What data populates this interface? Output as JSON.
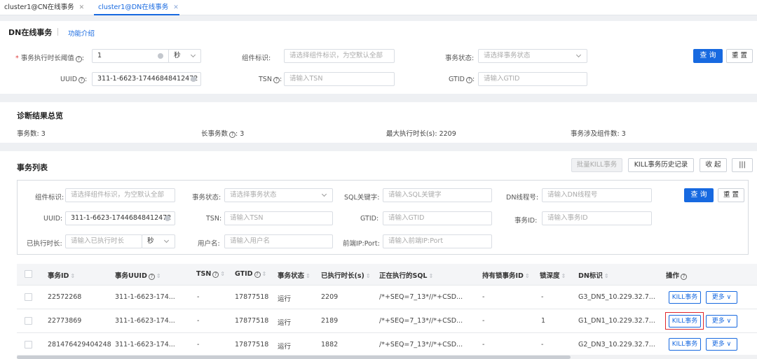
{
  "tabs": [
    {
      "label": "cluster1@CN在线事务",
      "active": false
    },
    {
      "label": "cluster1@DN在线事务",
      "active": true
    }
  ],
  "header": {
    "title": "DN在线事务",
    "intro_link": "功能介绍"
  },
  "query": {
    "threshold_label": "事务执行时长阈值",
    "threshold_value": "1",
    "unit": "秒",
    "component_label": "组件标识:",
    "component_placeholder": "请选择组件标识，为空默认全部",
    "state_label": "事务状态:",
    "state_placeholder": "请选择事务状态",
    "uuid_label": "UUID",
    "uuid_value": "311-1-6623-17446848412472",
    "tsn_label": "TSN",
    "tsn_placeholder": "请输入TSN",
    "gtid_label": "GTID",
    "gtid_placeholder": "请输入GTID",
    "search_btn": "查 询",
    "reset_btn": "重 置"
  },
  "summary": {
    "title": "诊断结果总览",
    "txn_count": "事务数: 3",
    "long_txn_label": "长事务数",
    "long_txn_value": ": 3",
    "max_duration": "最大执行时长(s): 2209",
    "components": "事务涉及组件数: 3"
  },
  "list": {
    "title": "事务列表",
    "batch_kill": "批量KILL事务",
    "kill_history": "KILL事务历史记录",
    "collapse": "收 起",
    "columns_icon": "|||",
    "filters": {
      "component_label": "组件标识:",
      "component_placeholder": "请选择组件标识，为空默认全部",
      "state_label": "事务状态:",
      "state_placeholder": "请选择事务状态",
      "sql_label": "SQL关键字:",
      "sql_placeholder": "请输入SQL关键字",
      "dn_thread_label": "DN线程号:",
      "dn_thread_placeholder": "请输入DN线程号",
      "uuid_label": "UUID:",
      "uuid_value": "311-1-6623-17446848412472",
      "tsn_label": "TSN:",
      "tsn_placeholder": "请输入TSN",
      "gtid_label": "GTID:",
      "gtid_placeholder": "请输入GTID",
      "txn_id_label": "事务ID:",
      "txn_id_placeholder": "请输入事务ID",
      "elapsed_label": "已执行时长:",
      "elapsed_placeholder": "请输入已执行时长",
      "elapsed_unit": "秒",
      "user_label": "用户名:",
      "user_placeholder": "请输入用户名",
      "ip_label": "前端IP:Port:",
      "ip_placeholder": "请输入前端IP:Port",
      "search_btn": "查 询",
      "reset_btn": "重 置"
    },
    "columns": [
      "事务ID",
      "事务UUID",
      "TSN",
      "GTID",
      "事务状态",
      "已执行时长(s)",
      "正在执行的SQL",
      "持有锁事务ID",
      "锁深度",
      "DN标识",
      "操作"
    ],
    "rows": [
      {
        "id": "22572268",
        "uuid": "311-1-6623-174...",
        "tsn": "-",
        "gtid": "17877518",
        "state": "运行",
        "elapsed": "2209",
        "sql": "/*+SEQ=7_13*//*+CSD...",
        "lock_holder": "-",
        "lock_depth": "-",
        "dn": "G3_DN5_10.229.32.7...",
        "kill": "KILL事务",
        "more": "更多",
        "highlight": false
      },
      {
        "id": "22773869",
        "uuid": "311-1-6623-174...",
        "tsn": "-",
        "gtid": "17877518",
        "state": "运行",
        "elapsed": "2189",
        "sql": "/*+SEQ=7_13*//*+CSD...",
        "lock_holder": "-",
        "lock_depth": "1",
        "dn": "G1_DN1_10.229.32.7...",
        "kill": "KILL事务",
        "more": "更多",
        "highlight": true
      },
      {
        "id": "281476429404248",
        "uuid": "311-1-6623-174...",
        "tsn": "-",
        "gtid": "17877518",
        "state": "运行",
        "elapsed": "1882",
        "sql": "/*+SEQ=7_13*//*+CSD...",
        "lock_holder": "-",
        "lock_depth": "-",
        "dn": "G2_DN3_10.229.32.7...",
        "kill": "KILL事务",
        "more": "更多",
        "highlight": false
      }
    ]
  },
  "colors": {
    "accent": "#1769e0",
    "highlight_border": "#e0262b"
  }
}
